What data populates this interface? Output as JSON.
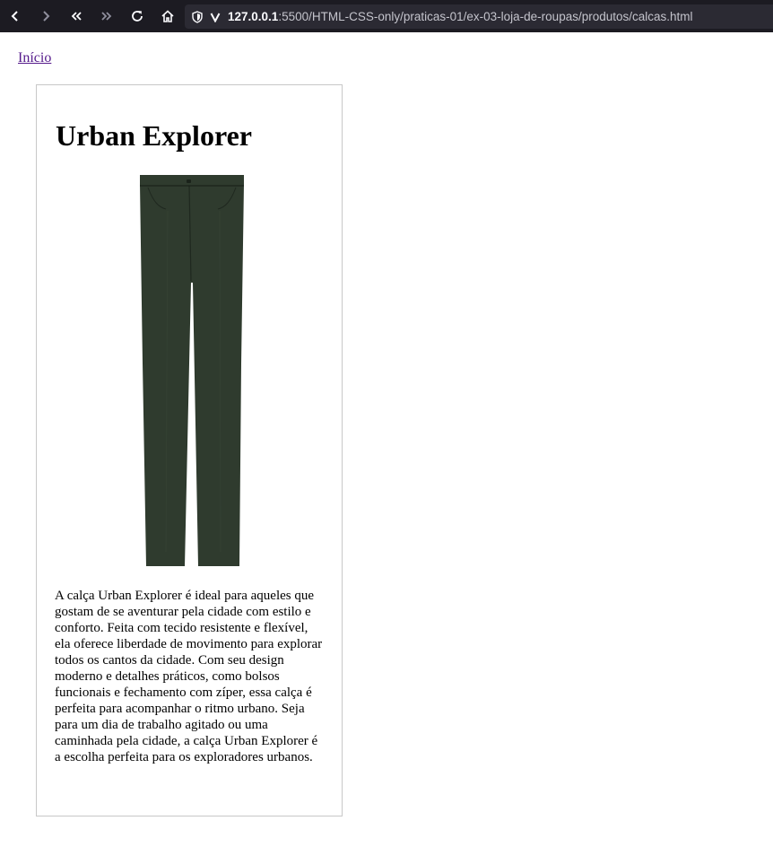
{
  "browser": {
    "url_host": "127.0.0.1",
    "url_path": ":5500/HTML-CSS-only/praticas-01/ex-03-loja-de-roupas/produtos/calcas.html"
  },
  "page": {
    "home_link": "Início",
    "product": {
      "title": "Urban Explorer",
      "image_color": "#2f3b2e",
      "description": "A calça Urban Explorer é ideal para aqueles que gostam de se aventurar pela cidade com estilo e conforto. Feita com tecido resistente e flexível, ela oferece liberdade de movimento para explorar todos os cantos da cidade. Com seu design moderno e detalhes práticos, como bolsos funcionais e fechamento com zíper, essa calça é perfeita para acompanhar o ritmo urbano. Seja para um dia de trabalho agitado ou uma caminhada pela cidade, a calça Urban Explorer é a escolha perfeita para os exploradores urbanos."
    }
  }
}
